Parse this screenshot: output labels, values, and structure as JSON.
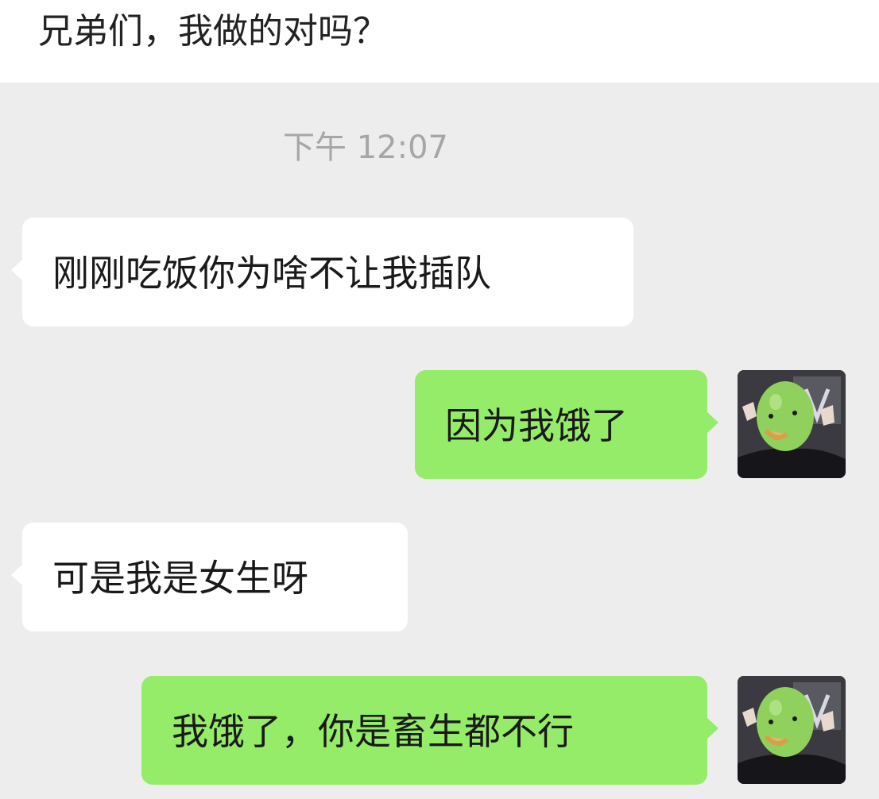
{
  "post": {
    "title": "兄弟们，我做的对吗？"
  },
  "chat": {
    "timestamp": "下午 12:07",
    "messages": [
      {
        "side": "incoming",
        "text": "刚刚吃饭你为啥不让我插队"
      },
      {
        "side": "outgoing",
        "text": "因为我饿了",
        "avatar": "green-mask-avatar"
      },
      {
        "side": "incoming",
        "text": "可是我是女生呀"
      },
      {
        "side": "outgoing",
        "text": "我饿了，你是畜生都不行",
        "avatar": "green-mask-avatar"
      }
    ]
  },
  "colors": {
    "background": "#ededed",
    "incoming_bubble": "#ffffff",
    "outgoing_bubble": "#95ec69",
    "timestamp_text": "#a6a6a6"
  }
}
